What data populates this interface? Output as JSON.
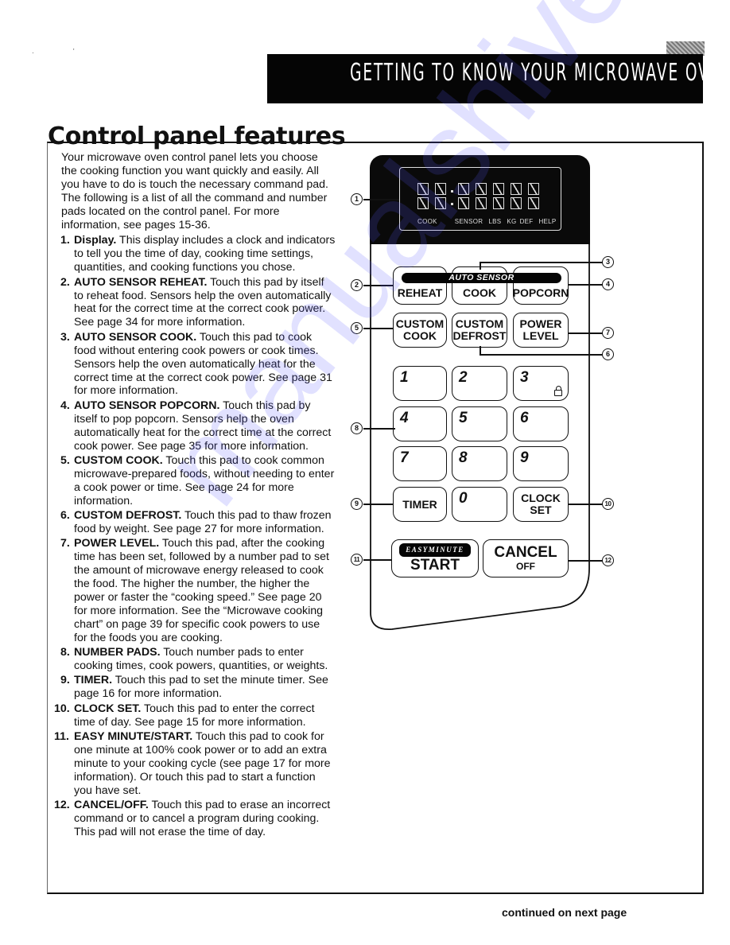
{
  "header": {
    "section_banner": "Getting to Know Your Microwave Oven",
    "page_title": "Control panel features"
  },
  "intro": "Your microwave oven control panel lets you choose the cooking function you want quickly and easily. All you have to do is touch the necessary command pad. The following is a list of all the command and number pads located on the control panel. For more information, see pages 15-36.",
  "features": [
    {
      "num": "1.",
      "title": "Display.",
      "text": " This display includes a clock and indicators to tell you the time of day, cooking time settings, quantities, and cooking functions you chose."
    },
    {
      "num": "2.",
      "title": "AUTO SENSOR REHEAT.",
      "text": " Touch this pad by itself to reheat food. Sensors help the oven automatically heat for the correct time at the correct cook power. See page 34 for more information."
    },
    {
      "num": "3.",
      "title": "AUTO SENSOR COOK.",
      "text": " Touch this pad to cook food without entering cook powers or cook times. Sensors help the oven automatically heat for the correct time at the correct cook power. See page 31 for more information."
    },
    {
      "num": "4.",
      "title": "AUTO SENSOR POPCORN.",
      "text": " Touch this pad by itself to pop popcorn. Sensors help the oven automatically heat for the correct time at the correct cook power. See page 35 for more information."
    },
    {
      "num": "5.",
      "title": "CUSTOM COOK.",
      "text": " Touch this pad to cook common microwave-prepared foods, without needing to enter a cook power or time. See page 24 for more information."
    },
    {
      "num": "6.",
      "title": "CUSTOM DEFROST.",
      "text": " Touch this pad to thaw frozen food by weight. See page 27 for more information."
    },
    {
      "num": "7.",
      "title": "POWER LEVEL.",
      "text": " Touch this pad, after the cooking time has been set, followed by a number pad to set the amount of microwave energy released to cook the food. The higher the number, the higher the power or faster the “cooking speed.” See page 20 for more information. See the “Microwave cooking chart” on page 39 for specific cook powers to use for the foods you are cooking."
    },
    {
      "num": "8.",
      "title": "NUMBER PADS.",
      "text": " Touch number pads to enter cooking times, cook powers, quantities, or weights."
    },
    {
      "num": "9.",
      "title": "TIMER.",
      "text": " Touch this pad to set the minute timer. See page 16 for more information."
    },
    {
      "num": "10.",
      "title": "CLOCK SET.",
      "text": " Touch this pad to enter the correct time of day. See page 15 for more information."
    },
    {
      "num": "11.",
      "title": "EASY MINUTE/START.",
      "text": " Touch this pad to cook for one minute at 100% cook power or to add an extra minute to your cooking cycle (see page 17 for more information). Or touch this pad to start a function you have set."
    },
    {
      "num": "12.",
      "title": "CANCEL/OFF.",
      "text": " Touch this pad to erase an incorrect command or to cancel a program during cooking. This pad will not erase the time of day."
    }
  ],
  "footer": {
    "continued": "continued on next page"
  },
  "diagram": {
    "display_indicators": [
      "COOK",
      "SENSOR",
      "LBS",
      "KG",
      "DEF",
      "HELP"
    ],
    "auto_sensor_label": "AUTO SENSOR",
    "pads": {
      "reheat": "REHEAT",
      "cook": "COOK",
      "popcorn": "POPCORN",
      "custom_cook_1": "CUSTOM",
      "custom_cook_2": "COOK",
      "custom_defrost_1": "CUSTOM",
      "custom_defrost_2": "DEFROST",
      "power_level_1": "POWER",
      "power_level_2": "LEVEL",
      "timer": "TIMER",
      "clock_set_1": "CLOCK",
      "clock_set_2": "SET",
      "easy_minute": "EASYMINUTE",
      "start": "START",
      "cancel": "CANCEL",
      "off": "OFF"
    },
    "number_pads": [
      "1",
      "2",
      "3",
      "4",
      "5",
      "6",
      "7",
      "8",
      "9",
      "0"
    ],
    "callouts": [
      "1",
      "2",
      "3",
      "4",
      "5",
      "6",
      "7",
      "8",
      "9",
      "10",
      "11",
      "12"
    ]
  },
  "watermark": "manualshive.com"
}
